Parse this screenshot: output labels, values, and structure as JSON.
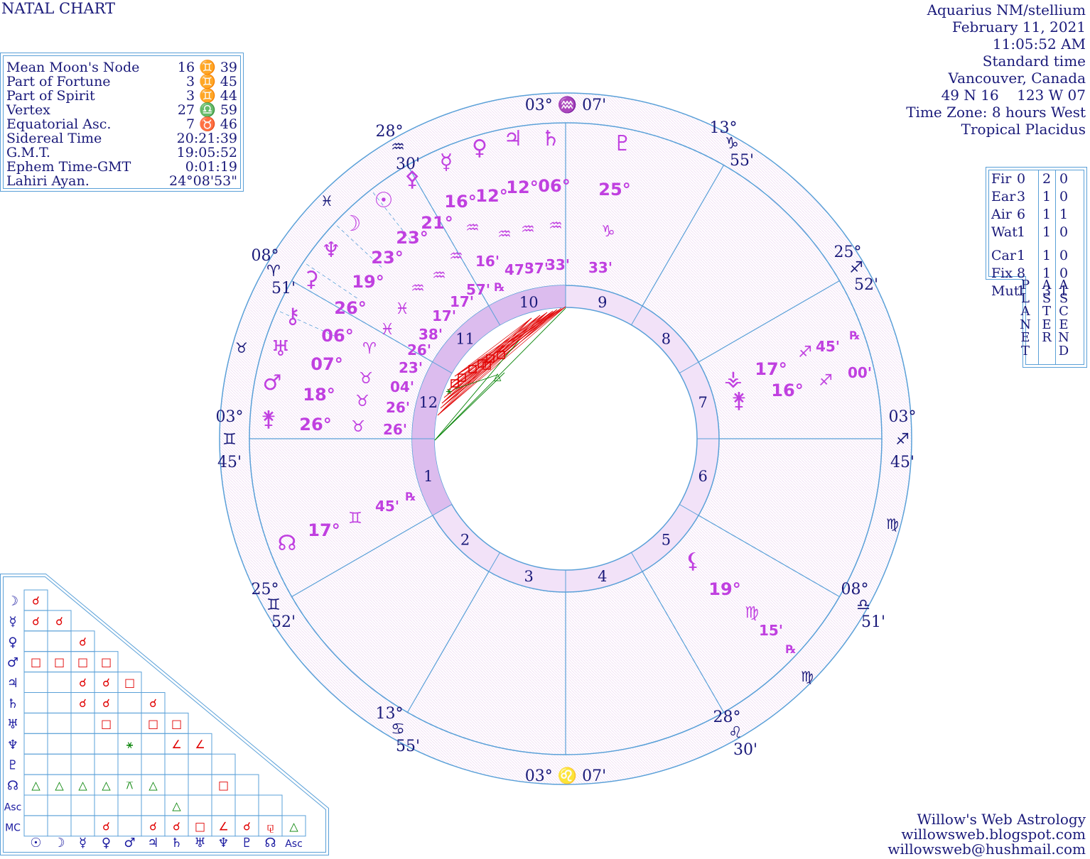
{
  "header": {
    "title": "NATAL CHART",
    "info_lines": [
      "Aquarius NM/stellium",
      "February 11, 2021",
      "11:05:52 AM",
      "Standard time",
      "Vancouver, Canada",
      "49 N 16    123 W 07",
      "Time Zone: 8 hours West",
      "Tropical Placidus"
    ]
  },
  "points_table": [
    {
      "label": "Mean Moon's Node",
      "value": "16 ♊ 39"
    },
    {
      "label": "Part of Fortune",
      "value": "3 ♊ 45"
    },
    {
      "label": "Part of Spirit",
      "value": "3 ♊ 44"
    },
    {
      "label": "Vertex",
      "value": "27 ♎ 59"
    },
    {
      "label": "Equatorial Asc.",
      "value": "7 ♉ 46"
    },
    {
      "label": "Sidereal Time",
      "value": "20:21:39"
    },
    {
      "label": "G.M.T.",
      "value": "19:05:52"
    },
    {
      "label": "Ephem Time-GMT",
      "value": "0:01:19"
    },
    {
      "label": "Lahiri Ayan.",
      "value": "24°08'53\""
    }
  ],
  "element_table": {
    "rows": [
      {
        "label": "Fir",
        "planet": "0",
        "aster": "2",
        "ascend": "0"
      },
      {
        "label": "Ear",
        "planet": "3",
        "aster": "1",
        "ascend": "0"
      },
      {
        "label": "Air",
        "planet": "6",
        "aster": "1",
        "ascend": "1"
      },
      {
        "label": "Wat",
        "planet": "1",
        "aster": "1",
        "ascend": "0"
      },
      {
        "label": "Car",
        "planet": "1",
        "aster": "1",
        "ascend": "0"
      },
      {
        "label": "Fix",
        "planet": "8",
        "aster": "1",
        "ascend": "0"
      },
      {
        "label": "Mut",
        "planet": "1",
        "aster": "3",
        "ascend": "1"
      }
    ],
    "col_planet": "PLANET",
    "col_aster": "ASTER",
    "col_ascend": "ASCEND"
  },
  "cusps": [
    {
      "deg": "03°",
      "sign": "♒",
      "min": "07'"
    },
    {
      "deg": "13°",
      "sign": "♑",
      "min": "55'"
    },
    {
      "deg": "25°",
      "sign": "♐",
      "min": "52'"
    },
    {
      "deg": "03°",
      "sign": "♐",
      "min": "45'"
    },
    {
      "deg": "08°",
      "sign": "♎",
      "min": "51'"
    },
    {
      "deg": "28°",
      "sign": "♌",
      "min": "30'"
    },
    {
      "deg": "03°",
      "sign": "♌",
      "min": "07'"
    },
    {
      "deg": "13°",
      "sign": "♋",
      "min": "55'"
    },
    {
      "deg": "25°",
      "sign": "♊",
      "min": "52'"
    },
    {
      "deg": "03°",
      "sign": "♊",
      "min": "45'"
    },
    {
      "deg": "08°",
      "sign": "♈",
      "min": "51'"
    },
    {
      "deg": "28°",
      "sign": "♒",
      "min": "30'"
    }
  ],
  "house_numbers": [
    "1",
    "2",
    "3",
    "4",
    "5",
    "6",
    "7",
    "8",
    "9",
    "10",
    "11",
    "12"
  ],
  "planets_top": [
    {
      "glyph": "♇",
      "deg": "25°",
      "sign": "♑",
      "min": "33'",
      "retro": ""
    },
    {
      "glyph": "♄",
      "deg": "06°",
      "sign": "♒",
      "min": "33'",
      "retro": ""
    },
    {
      "glyph": "♃",
      "deg": "12°",
      "sign": "♒",
      "min": "37'",
      "retro": ""
    },
    {
      "glyph": "♀",
      "deg": "12°",
      "sign": "♒",
      "min": "47'",
      "retro": ""
    },
    {
      "glyph": "☿",
      "deg": "16°",
      "sign": "♒",
      "min": "16'",
      "retro": "℞"
    },
    {
      "glyph": "⚴",
      "deg": "21°",
      "sign": "♒",
      "min": "57'",
      "retro": ""
    },
    {
      "glyph": "☉",
      "deg": "23°",
      "sign": "♒",
      "min": "17'",
      "retro": ""
    },
    {
      "glyph": "☽",
      "deg": "23°",
      "sign": "♒",
      "min": "17'",
      "retro": ""
    },
    {
      "glyph": "♆",
      "deg": "19°",
      "sign": "♓",
      "min": "38'",
      "retro": ""
    },
    {
      "glyph": "⚳",
      "deg": "26°",
      "sign": "♓",
      "min": "26'",
      "retro": ""
    },
    {
      "glyph": "⚷",
      "deg": "06°",
      "sign": "♈",
      "min": "23'",
      "retro": ""
    },
    {
      "glyph": "♅",
      "deg": "07°",
      "sign": "♉",
      "min": "04'",
      "retro": ""
    },
    {
      "glyph": "♂",
      "deg": "18°",
      "sign": "♉",
      "min": "26'",
      "retro": ""
    },
    {
      "glyph": "⚵",
      "deg": "26°",
      "sign": "♉",
      "min": "26'",
      "retro": ""
    }
  ],
  "planets_other": [
    {
      "glyph": "⚶",
      "deg": "17°",
      "sign": "♐",
      "min": "45'",
      "retro": "℞"
    },
    {
      "glyph": "⚵",
      "deg": "16°",
      "sign": "♐",
      "min": "00'",
      "retro": ""
    },
    {
      "glyph": "☊",
      "deg": "17°",
      "sign": "♊",
      "min": "45'",
      "retro": "℞"
    },
    {
      "glyph": "⚸",
      "deg": "19°",
      "sign": "♍",
      "min": "15'",
      "retro": "℞"
    }
  ],
  "aspect_grid": {
    "row_glyphs": [
      "☽",
      "☿",
      "♀",
      "♂",
      "♃",
      "♄",
      "♅",
      "♆",
      "♇",
      "☊",
      "Asc",
      "MC"
    ],
    "col_glyphs": [
      "☉",
      "☽",
      "☿",
      "♀",
      "♂",
      "♃",
      "♄",
      "♅",
      "♆",
      "♇",
      "☊",
      "Asc"
    ],
    "rows": [
      [
        "☌"
      ],
      [
        "☌",
        "☌"
      ],
      [
        "",
        "",
        "☌"
      ],
      [
        "□",
        "□",
        "□",
        "□"
      ],
      [
        "",
        "",
        "☌",
        "☌",
        "□"
      ],
      [
        "",
        "",
        "☌",
        "☌",
        "",
        "☌"
      ],
      [
        "",
        "",
        "",
        "□",
        "",
        "□",
        "□"
      ],
      [
        "",
        "",
        "",
        "",
        "⚹",
        "",
        "∠",
        "∠"
      ],
      [
        "",
        "",
        "",
        "",
        "",
        "",
        "",
        "",
        ""
      ],
      [
        "△",
        "△",
        "△",
        "△",
        "⚻",
        "△",
        "",
        "",
        "□",
        ""
      ],
      [
        "",
        "",
        "",
        "",
        "",
        "",
        "△",
        "",
        "",
        "",
        ""
      ],
      [
        "",
        "",
        "",
        "☌",
        "",
        "☌",
        "☌",
        "□",
        "∠",
        "☌",
        "⚼",
        "△"
      ]
    ]
  },
  "footer": [
    "Willow's Web Astrology",
    "willowsweb.blogspot.com",
    "willowsweb@hushmail.com"
  ],
  "colors": {
    "text": "#1a1a7a",
    "ring": "#5aa0d8",
    "planet": "#c040e0",
    "hard": "#e00000",
    "soft": "#008000",
    "houseband": "#e2c8f0"
  }
}
